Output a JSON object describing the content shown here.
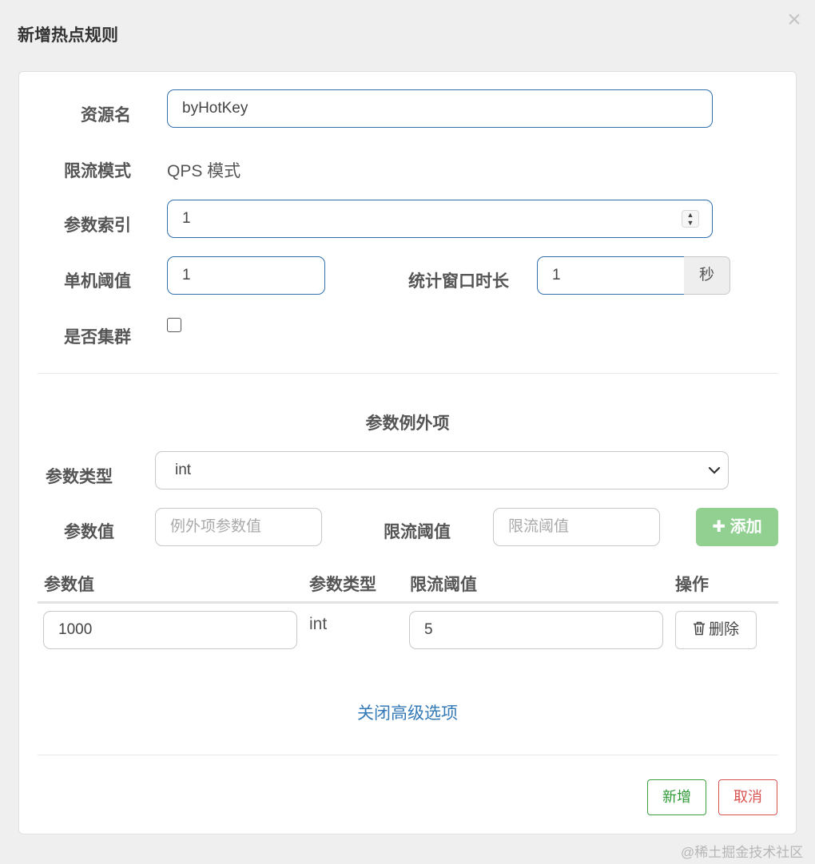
{
  "dialog": {
    "title": "新增热点规则",
    "close_symbol": "×"
  },
  "form": {
    "resource_label": "资源名",
    "resource_value": "byHotKey",
    "mode_label": "限流模式",
    "mode_value": "QPS 模式",
    "param_index_label": "参数索引",
    "param_index_value": "1",
    "threshold_label": "单机阈值",
    "threshold_value": "1",
    "window_label": "统计窗口时长",
    "window_value": "1",
    "window_unit": "秒",
    "cluster_label": "是否集群",
    "cluster_checked": false
  },
  "exceptions": {
    "section_title": "参数例外项",
    "type_label": "参数类型",
    "type_selected": "int",
    "value_label": "参数值",
    "value_placeholder": "例外项参数值",
    "limit_label": "限流阈值",
    "limit_placeholder": "限流阈值",
    "add_button": "添加",
    "table": {
      "headers": [
        "参数值",
        "参数类型",
        "限流阈值",
        "操作"
      ],
      "rows": [
        {
          "value": "1000",
          "type": "int",
          "limit": "5",
          "action": "删除"
        }
      ]
    }
  },
  "advanced_link": "关闭高级选项",
  "footer": {
    "add_label": "新增",
    "cancel_label": "取消"
  },
  "watermark": "@稀土掘金技术社区",
  "colors": {
    "input_border_active": "#2f6fae",
    "add_button_bg": "#92d092",
    "link": "#337ab7",
    "success": "#3aa040",
    "danger": "#d9534f"
  },
  "icons": [
    "close-icon",
    "spinner-icon",
    "chevron-down-icon",
    "plus-icon",
    "trash-icon"
  ]
}
